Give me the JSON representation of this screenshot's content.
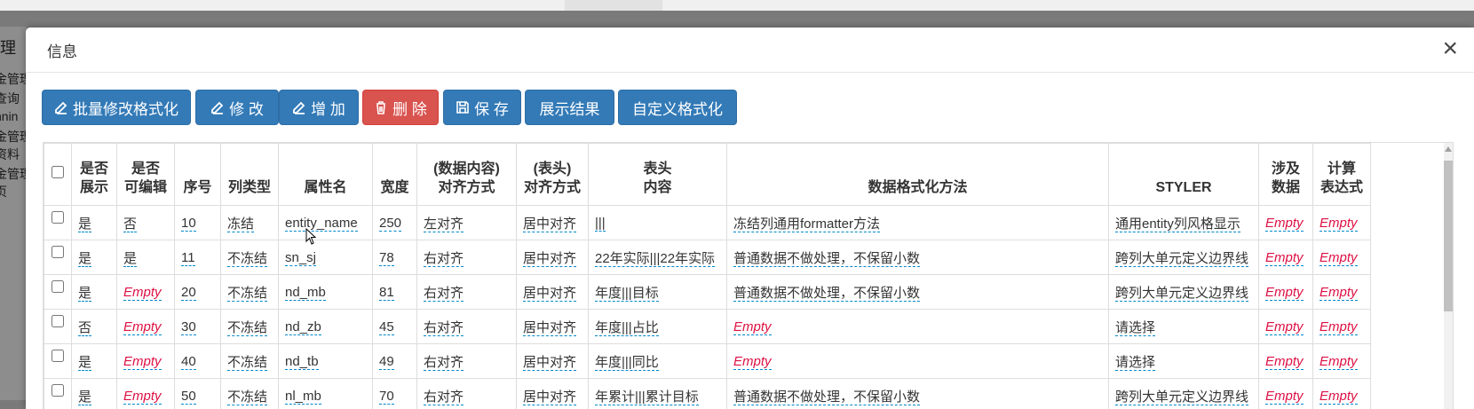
{
  "background": {
    "side_texts": [
      "理",
      "金管理",
      "查询",
      "nnin",
      "金管理",
      "资料",
      "金管理",
      "页"
    ]
  },
  "modal": {
    "title": "信息",
    "close_label": "×"
  },
  "toolbar": {
    "buttons": [
      {
        "label": "批量修改格式化",
        "icon": "edit-icon"
      },
      {
        "label": "修 改",
        "icon": "edit-icon"
      },
      {
        "label": "增 加",
        "icon": "edit-icon"
      },
      {
        "label": "删 除",
        "icon": "trash-icon"
      },
      {
        "label": "保 存",
        "icon": "save-icon"
      },
      {
        "label": "展示结果",
        "icon": ""
      },
      {
        "label": "自定义格式化",
        "icon": ""
      }
    ]
  },
  "colors": {
    "primary": "#337ab7",
    "danger": "#d9534f",
    "empty_text": "#dd1144",
    "editable_underline": "#0088cc"
  },
  "table": {
    "headers": [
      "",
      "是否\n展示",
      "是否\n可编辑",
      "序号",
      "列类型",
      "属性名",
      "宽度",
      "(数据内容)\n对齐方式",
      "(表头)\n对齐方式",
      "表头\n内容",
      "数据格式化方法",
      "STYLER",
      "涉及\n数据",
      "计算\n表达式"
    ],
    "rows": [
      [
        "是",
        "否",
        "10",
        "冻结",
        "entity_name",
        "250",
        "左对齐",
        "居中对齐",
        "|||",
        "冻结列通用formatter方法",
        "通用entity列风格显示",
        "Empty",
        "Empty"
      ],
      [
        "是",
        "是",
        "11",
        "不冻结",
        "sn_sj",
        "78",
        "右对齐",
        "居中对齐",
        "22年实际|||22年实际",
        "普通数据不做处理，不保留小数",
        "跨列大单元定义边界线",
        "Empty",
        "Empty"
      ],
      [
        "是",
        "Empty",
        "20",
        "不冻结",
        "nd_mb",
        "81",
        "右对齐",
        "居中对齐",
        "年度|||目标",
        "普通数据不做处理，不保留小数",
        "跨列大单元定义边界线",
        "Empty",
        "Empty"
      ],
      [
        "否",
        "Empty",
        "30",
        "不冻结",
        "nd_zb",
        "45",
        "右对齐",
        "居中对齐",
        "年度|||占比",
        "Empty",
        "请选择",
        "Empty",
        "Empty"
      ],
      [
        "是",
        "Empty",
        "40",
        "不冻结",
        "nd_tb",
        "49",
        "右对齐",
        "居中对齐",
        "年度|||同比",
        "Empty",
        "请选择",
        "Empty",
        "Empty"
      ],
      [
        "是",
        "Empty",
        "50",
        "不冻结",
        "nl_mb",
        "70",
        "右对齐",
        "居中对齐",
        "年累计|||累计目标",
        "普通数据不做处理，不保留小数",
        "跨列大单元定义边界线",
        "Empty",
        "Empty"
      ]
    ]
  }
}
